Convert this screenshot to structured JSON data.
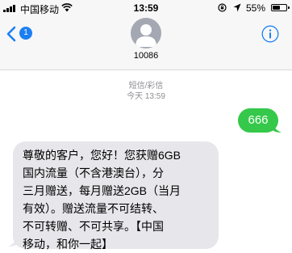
{
  "status_bar": {
    "carrier": "中国移动",
    "time": "13:59",
    "battery_pct": "55%",
    "battery_level": 0.55
  },
  "header": {
    "unread_count": "1",
    "contact": "10086",
    "icons": {
      "back": "chevron-left-icon",
      "avatar": "person-icon",
      "info": "info-icon"
    }
  },
  "thread": {
    "message_type": "短信/彩信",
    "timestamp": "今天 13:59",
    "outgoing": {
      "text": "666"
    },
    "incoming": {
      "lines": [
        "尊敬的客户，您好！您获赠6GB",
        "国内流量（不含港澳台），分",
        "三月赠送，每月赠送2GB（当月",
        "有效）。赠送流量不可结转、",
        "不可转赠、不可共享。【中国",
        "移动，和你一起】"
      ]
    }
  },
  "colors": {
    "accent": "#1c7ff1",
    "outgoing_bubble": "#35c84a",
    "incoming_bubble": "#e6e6eb",
    "meta_text": "#8e8e93"
  }
}
